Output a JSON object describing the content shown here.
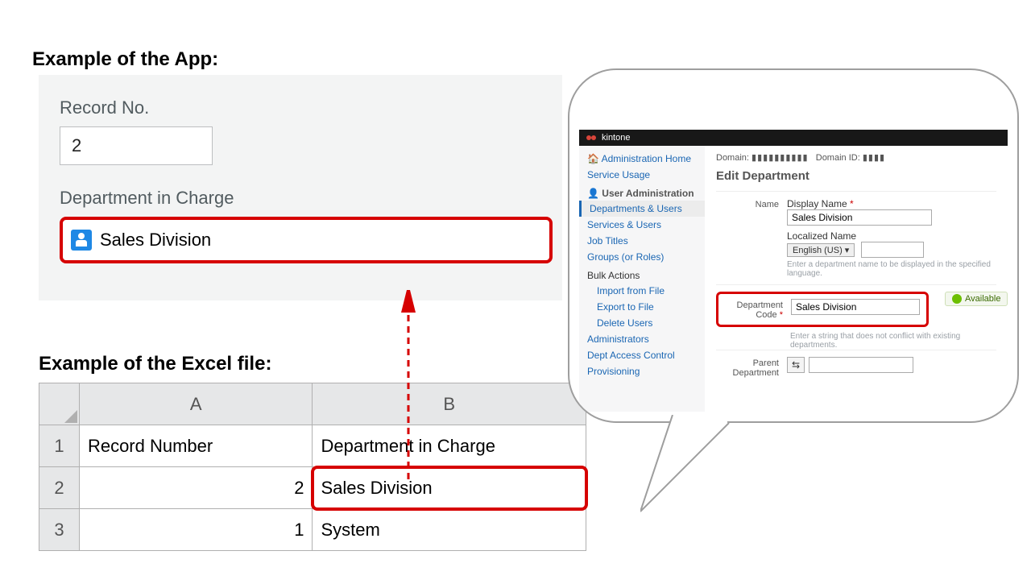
{
  "headings": {
    "app": "Example of the App:",
    "excel": "Example of the Excel file:"
  },
  "app_panel": {
    "record_no_label": "Record No.",
    "record_no_value": "2",
    "dept_label": "Department in Charge",
    "dept_value": "Sales Division"
  },
  "excel": {
    "colA": "A",
    "colB": "B",
    "rows": [
      {
        "n": "1",
        "a": "Record Number",
        "b": "Department in Charge"
      },
      {
        "n": "2",
        "a": "2",
        "b": "Sales Division"
      },
      {
        "n": "3",
        "a": "1",
        "b": "System"
      }
    ]
  },
  "kintone": {
    "brand": "kintone",
    "domain_label": "Domain:",
    "domain_id_label": "Domain ID:",
    "side": {
      "admin_home": "Administration Home",
      "service_usage": "Service Usage",
      "user_admin": "User Administration",
      "dept_users": "Departments & Users",
      "services_users": "Services & Users",
      "job_titles": "Job Titles",
      "groups": "Groups (or Roles)",
      "bulk": "Bulk Actions",
      "import": "Import from File",
      "export": "Export to File",
      "delete": "Delete Users",
      "admins": "Administrators",
      "access": "Dept Access Control",
      "prov": "Provisioning"
    },
    "page_title": "Edit Department",
    "form": {
      "name_label": "Name",
      "display_name_label": "Display Name",
      "display_name_value": "Sales Division",
      "localized_label": "Localized Name",
      "lang_option": "English (US)  ▾",
      "localized_hint": "Enter a department name to be displayed in the specified language.",
      "code_label": "Department Code",
      "code_value": "Sales Division",
      "available": "Available",
      "code_hint": "Enter a string that does not conflict with existing departments.",
      "parent_label": "Parent Department",
      "tree_glyph": "⇆"
    }
  }
}
